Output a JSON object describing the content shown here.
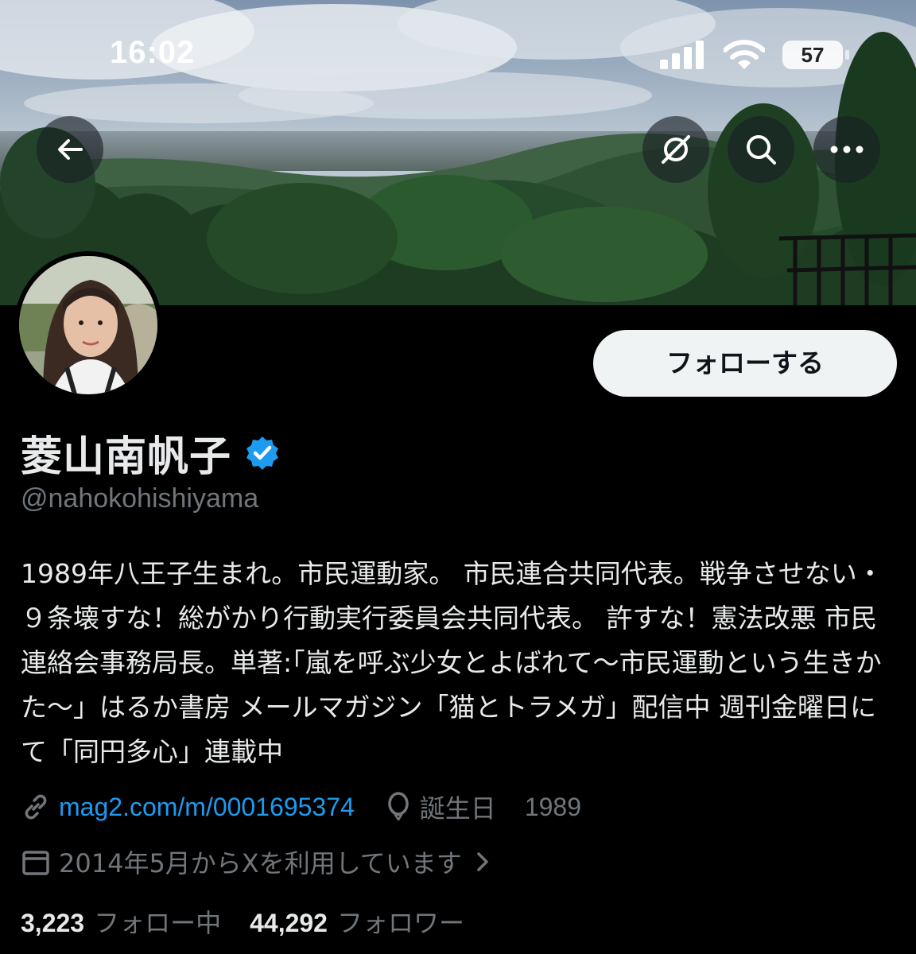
{
  "status_bar": {
    "time": "16:02",
    "battery": "57",
    "icons": [
      "cellular-signal-icon",
      "wifi-icon",
      "battery-icon"
    ]
  },
  "header": {
    "back_icon": "arrow-left-icon",
    "grok_icon": "grok-icon",
    "search_icon": "search-icon",
    "more_icon": "more-horizontal-icon"
  },
  "profile": {
    "display_name": "菱山南帆子",
    "verified": true,
    "handle": "@nahokohishiyama",
    "follow_label": "フォローする",
    "bio": "1989年八王子生まれ。市民運動家。 市民連合共同代表。戦争させない・９条壊すな！総がかり行動実行委員会共同代表。 許すな！憲法改悪 市民連絡会事務局長。単著:｢嵐を呼ぶ少女とよばれて〜市民運動という生きかた〜」はるか書房 メールマガジン「猫とトラメガ」配信中 週刊金曜日にて「同円多心」連載中",
    "link": "mag2.com/m/0001695374",
    "birthday_label": "誕生日",
    "birthday_value": "1989",
    "joined": "2014年5月からXを利用しています"
  },
  "stats": {
    "following_count": "3,223",
    "following_label": "フォロー中",
    "followers_count": "44,292",
    "followers_label": "フォロワー"
  },
  "colors": {
    "background": "#000000",
    "text_primary": "#e7e9ea",
    "text_secondary": "#71767b",
    "link": "#1d9bf0",
    "verified": "#1d9bf0",
    "follow_button_bg": "#eff3f4"
  }
}
